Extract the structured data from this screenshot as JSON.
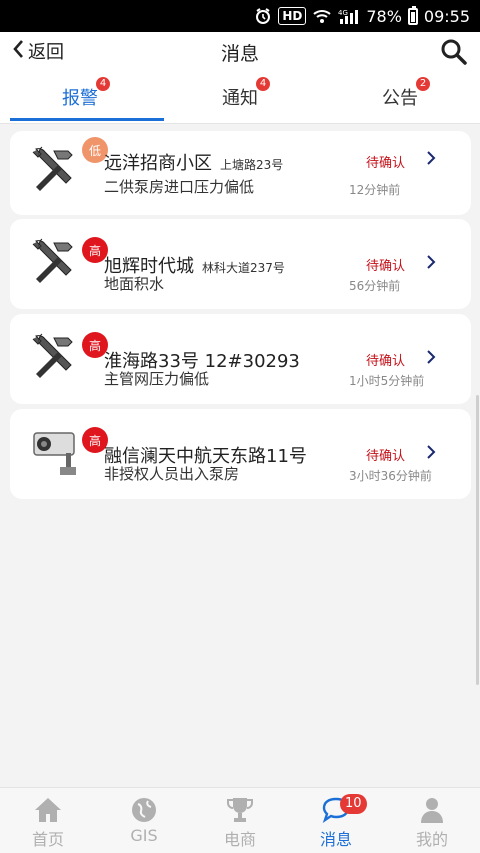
{
  "status_bar": {
    "network": "HD",
    "signal": "4G",
    "battery": "78%",
    "time": "09:55"
  },
  "header": {
    "back_label": "返回",
    "title": "消息"
  },
  "tabs": [
    {
      "label": "报警",
      "badge": "4",
      "active": true
    },
    {
      "label": "通知",
      "badge": "4",
      "active": false
    },
    {
      "label": "公告",
      "badge": "2",
      "active": false
    }
  ],
  "alarms": [
    {
      "icon": "wrench-hammer-icon",
      "level": "低",
      "name": "远洋招商小区",
      "address": "上塘路23号",
      "desc": "二供泵房进口压力偏低",
      "status": "待确认",
      "time": "12分钟前"
    },
    {
      "icon": "wrench-hammer-icon",
      "level": "高",
      "name": "旭辉时代城",
      "address": "林科大道237号",
      "desc": "地面积水",
      "status": "待确认",
      "time": "56分钟前"
    },
    {
      "icon": "wrench-hammer-icon",
      "level": "高",
      "name": "淮海路33号 12#30293",
      "address": "",
      "desc": "主管网压力偏低",
      "status": "待确认",
      "time": "1小时5分钟前"
    },
    {
      "icon": "security-camera-icon",
      "level": "高",
      "name": "融信澜天中航天东路11号",
      "address": "",
      "desc": "非授权人员出入泵房",
      "status": "待确认",
      "time": "3小时36分钟前"
    }
  ],
  "bottom_nav": [
    {
      "label": "首页",
      "icon": "home-icon"
    },
    {
      "label": "GIS",
      "icon": "globe-icon"
    },
    {
      "label": "电商",
      "icon": "trophy-icon"
    },
    {
      "label": "消息",
      "icon": "chat-icon",
      "badge": "10",
      "active": true
    },
    {
      "label": "我的",
      "icon": "person-icon"
    }
  ],
  "colors": {
    "accent": "#1b6fd6",
    "danger": "#e0161e",
    "low": "#f0946a",
    "status": "#c4121a"
  }
}
